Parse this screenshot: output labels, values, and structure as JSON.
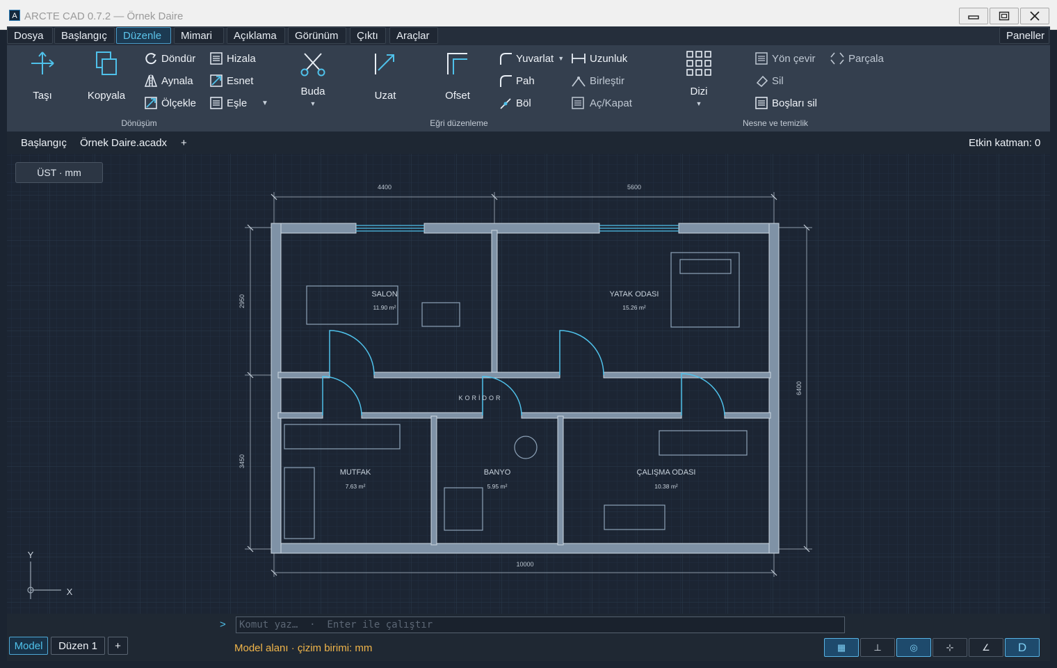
{
  "window": {
    "app_icon": "A",
    "title": "ARCTE CAD 0.7.2 — Örnek Daire",
    "buttons": [
      "minimize-icon",
      "maximize-icon",
      "close-icon"
    ]
  },
  "menu": {
    "items": [
      "Dosya",
      "Başlangıç",
      "Düzenle",
      "Mimari",
      "Açıklama",
      "Görünüm",
      "Çıktı",
      "Araçlar"
    ],
    "active": "Düzenle",
    "panels": "Paneller"
  },
  "ribbon": {
    "move": "Taşı",
    "copy": "Kopyala",
    "rotate": "Döndür",
    "mirror": "Aynala",
    "scale": "Ölçekle",
    "align": "Hizala",
    "stretch": "Esnet",
    "match": "Eşle",
    "trim": "Buda",
    "extend": "Uzat",
    "offset": "Ofset",
    "fillet": "Yuvarlat",
    "chamfer": "Pah",
    "break": "Böl",
    "lengthen": "Uzunluk",
    "join": "Birleştir",
    "open_close": "Aç/Kapat",
    "array": "Dizi",
    "reverse": "Yön çevir",
    "erase": "Sil",
    "purge": "Boşları sil",
    "explode": "Parçala",
    "groups": {
      "transform": "Dönüşüm",
      "curve_edit": "Eğri düzenleme",
      "object_cleanup": "Nesne ve temizlik"
    }
  },
  "docbar": {
    "tabs": [
      "Başlangıç",
      "Örnek Daire.acadx"
    ],
    "add": "+",
    "active_layer": "Etkin katman: 0"
  },
  "viewport": {
    "view_label": "ÜST · mm",
    "axis_x": "X",
    "axis_y": "Y"
  },
  "drawing": {
    "dims": {
      "top_left": "4400",
      "top_right": "5600",
      "bottom": "10000",
      "left_upper": "2950",
      "left_lower": "3450",
      "right": "6400"
    },
    "rooms": [
      {
        "name": "SALON",
        "area": "11.90 m²"
      },
      {
        "name": "YATAK ODASI",
        "area": "15.26 m²"
      },
      {
        "name": "KORİDOR",
        "area": ""
      },
      {
        "name": "MUTFAK",
        "area": "7.63 m²"
      },
      {
        "name": "BANYO",
        "area": "5.95 m²"
      },
      {
        "name": "ÇALIŞMA ODASI",
        "area": "10.38 m²"
      }
    ]
  },
  "command": {
    "prompt": ">",
    "placeholder": "Komut yaz…  ·  Enter ile çalıştır",
    "status": "Model alanı · çizim birimi: mm"
  },
  "layout_tabs": [
    "Model",
    "Düzen 1",
    "+"
  ],
  "status_buttons": [
    {
      "icon": "grid-icon",
      "glyph": "▦",
      "on": true
    },
    {
      "icon": "ortho-icon",
      "glyph": "⊥",
      "on": false
    },
    {
      "icon": "snap-icon",
      "glyph": "◎",
      "on": true
    },
    {
      "icon": "tracking-icon",
      "glyph": "⊹",
      "on": false
    },
    {
      "icon": "polar-icon",
      "glyph": "∠",
      "on": false
    },
    {
      "icon": "dynamic-input-icon",
      "glyph": "D",
      "on": true
    }
  ],
  "colors": {
    "accent": "#4fc1ea",
    "wall": "#8597aa",
    "status_text": "#f0b54a"
  }
}
